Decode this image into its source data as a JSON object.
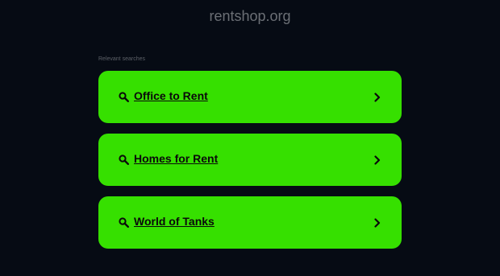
{
  "header": {
    "domain": "rentshop.org"
  },
  "section": {
    "heading": "Relevant searches"
  },
  "results": [
    {
      "label": "Office to Rent"
    },
    {
      "label": "Homes for Rent"
    },
    {
      "label": "World of Tanks"
    }
  ],
  "colors": {
    "background": "#060b14",
    "accent": "#36e000",
    "text_dark": "#0a0a0a",
    "muted": "#6b6f75"
  },
  "icons": {
    "search": "search-icon",
    "chevron": "chevron-right-icon"
  }
}
